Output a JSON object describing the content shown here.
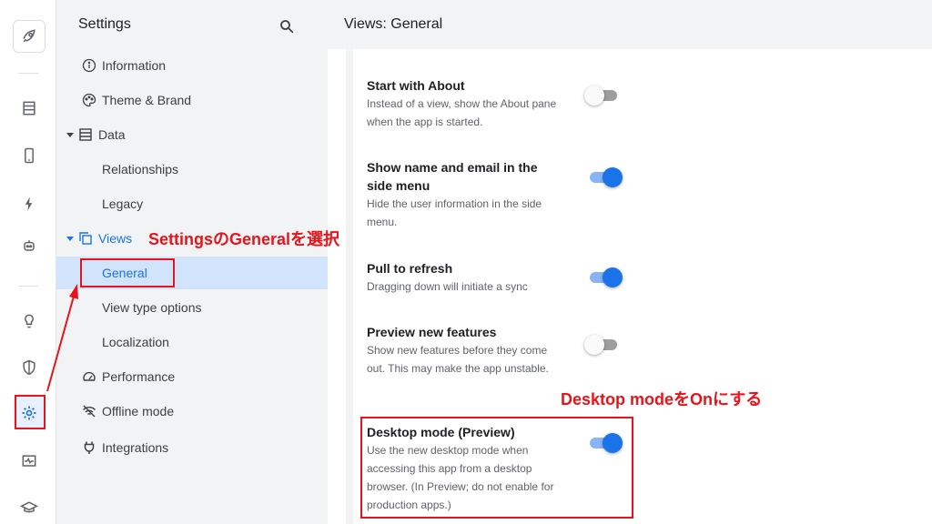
{
  "sidebar": {
    "title": "Settings",
    "items": [
      {
        "label": "Information",
        "icon": "info-icon"
      },
      {
        "label": "Theme & Brand",
        "icon": "palette-icon"
      },
      {
        "label": "Data",
        "icon": "table-icon"
      },
      {
        "label": "Relationships"
      },
      {
        "label": "Legacy"
      },
      {
        "label": "Views",
        "icon": "views-icon"
      },
      {
        "label": "General"
      },
      {
        "label": "View type options"
      },
      {
        "label": "Localization"
      },
      {
        "label": "Performance",
        "icon": "speedometer-icon"
      },
      {
        "label": "Offline mode",
        "icon": "wifi-off-icon"
      },
      {
        "label": "Integrations",
        "icon": "plug-icon"
      }
    ]
  },
  "main": {
    "title": "Views: General",
    "settings": [
      {
        "title": "Start with About",
        "desc": "Instead of a view, show the About pane when the app is started.",
        "enabled": false
      },
      {
        "title": "Show name and email in the side menu",
        "desc": "Hide the user information in the side menu.",
        "enabled": true
      },
      {
        "title": "Pull to refresh",
        "desc": "Dragging down will initiate a sync",
        "enabled": true
      },
      {
        "title": "Preview new features",
        "desc": "Show new features before they come out. This may make the app unstable.",
        "enabled": false
      },
      {
        "title": "Desktop mode (Preview)",
        "desc": "Use the new desktop mode when accessing this app from a desktop browser. (In Preview; do not enable for production apps.)",
        "enabled": true
      }
    ]
  },
  "annotations": {
    "general": "SettingsのGeneralを選択",
    "desktop": "Desktop modeをOnにする"
  },
  "colors": {
    "accent": "#1a73e8",
    "annotation": "#e8141b",
    "sidebar_bg": "#f1f3f4",
    "selected_bg": "#d2e3fc"
  }
}
